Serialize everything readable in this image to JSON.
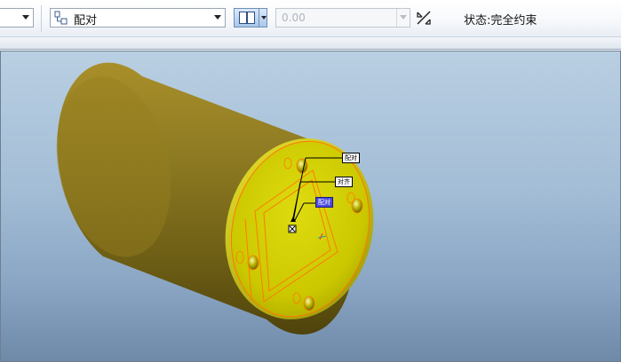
{
  "toolbar": {
    "left_combo_value": "",
    "constraint_type": "配对",
    "offset_value": "0.00",
    "status": "状态:完全约束"
  },
  "viewport": {
    "tags": {
      "tag1": "配对",
      "tag2": "对齐",
      "tag3": "配对"
    }
  },
  "colors": {
    "cylinder_body": "#8d7a22",
    "selected_face": "#d7d400",
    "highlight_edge": "#ff7a00",
    "viewport_top": "#b9cfe2",
    "viewport_bottom": "#6f89a8",
    "tag_selected": "#4c4ce0"
  },
  "icons": {
    "constraint": "constraint-type-icon",
    "flip": "flip-constraint-icon",
    "offset": "offset-arrow-icon"
  }
}
